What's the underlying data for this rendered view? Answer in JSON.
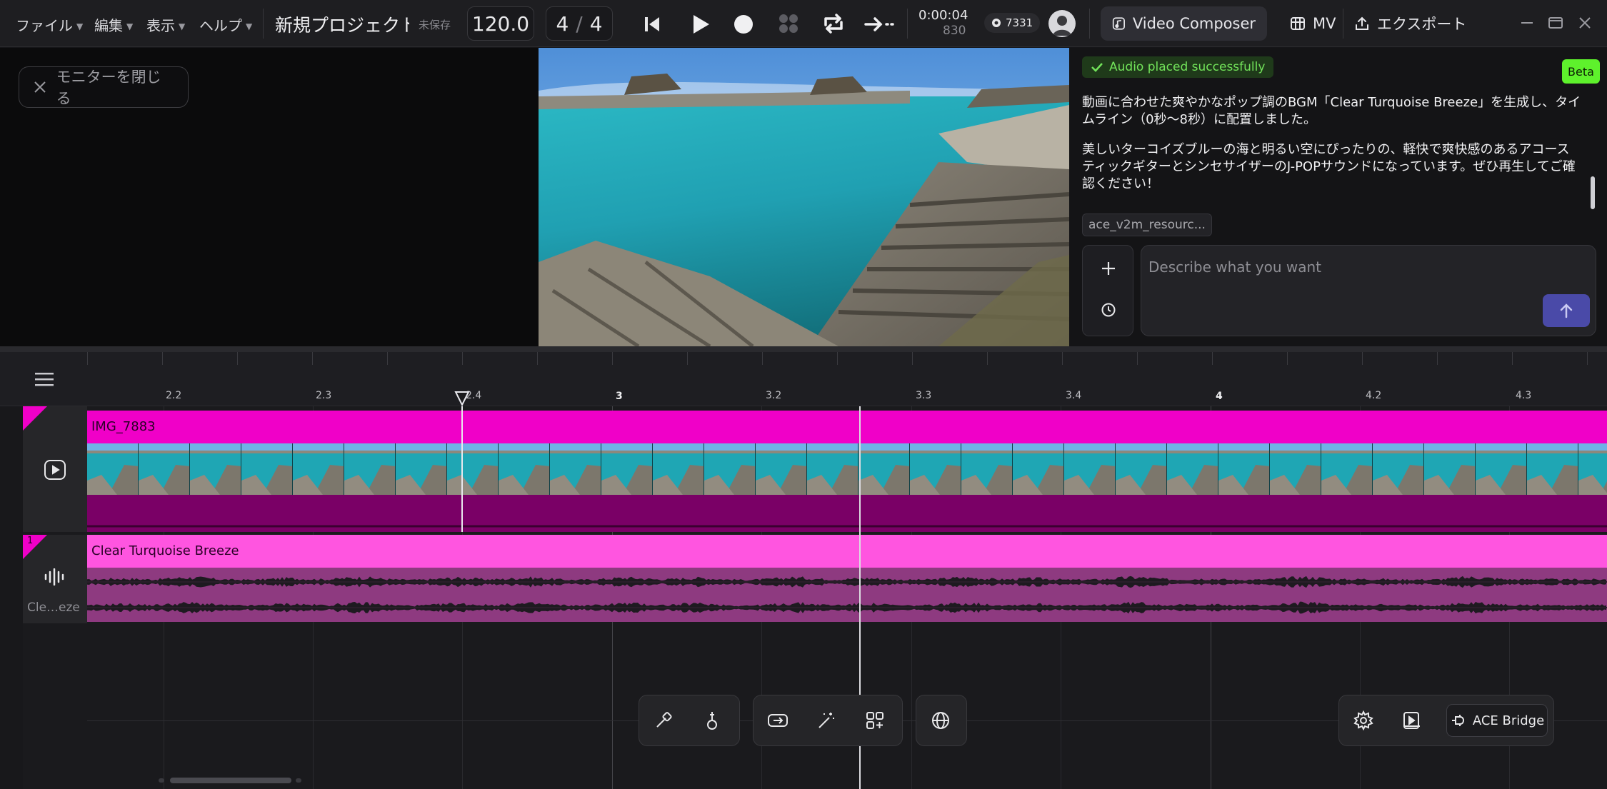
{
  "menu": {
    "file": "ファイル",
    "edit": "編集",
    "view": "表示",
    "help": "ヘルプ"
  },
  "project": {
    "title": "新規プロジェクト",
    "save_state": "未保存"
  },
  "transport": {
    "bpm": "120.0",
    "time_sig_num": "4",
    "time_sig_sep": "/",
    "time_sig_den": "4",
    "time": "0:00:04",
    "frames": "830",
    "credits": "7331"
  },
  "modes": {
    "video_composer": "Video Composer",
    "mv": "MV",
    "export": "エクスポート"
  },
  "monitor": {
    "close_label": "モニターを閉じる"
  },
  "chat": {
    "status": "Audio placed successfully",
    "beta": "Beta",
    "message_1": "動画に合わせた爽やかなポップ調のBGM「Clear Turquoise Breeze」を生成し、タイムライン（0秒〜8秒）に配置しました。",
    "message_2": "美しいターコイズブルーの海と明るい空にぴったりの、軽快で爽快感のあるアコースティックギターとシンセサイザーのJ-POPサウンドになっています。ぜひ再生してご確認ください！",
    "resource_chip": "ace_v2m_resourc...",
    "placeholder": "Describe what you want"
  },
  "timeline": {
    "ruler": {
      "labels": [
        "2.2",
        "2.3",
        "2.4",
        "3",
        "3.2",
        "3.3",
        "3.4",
        "4",
        "4.2",
        "4.3"
      ],
      "major": [
        "3",
        "4"
      ]
    },
    "tracks": {
      "video_clip": "IMG_7883",
      "audio_number": "1",
      "audio_clip": "Clear Turquoise Breeze",
      "audio_track_name": "Cle…eze"
    }
  },
  "dock": {
    "ace_bridge": "ACE Bridge"
  },
  "colors": {
    "accent_magenta": "#f000c8",
    "audio_pink": "#ff55e0",
    "success_green": "#72e35a",
    "beta_green": "#5ef12c",
    "send_purple": "#4a4aa8"
  },
  "icons": [
    "chevron-down-icon",
    "skip-back-icon",
    "play-icon",
    "record-icon",
    "grid-icon",
    "loop-icon",
    "arrow-right-icon",
    "credit-icon",
    "avatar",
    "music-note-icon",
    "globe-icon",
    "upload-icon",
    "minimize-icon",
    "maximize-icon",
    "close-icon",
    "check-icon",
    "plus-icon",
    "history-icon",
    "arrow-up-icon",
    "hamburger-icon",
    "video-icon",
    "waveform-icon",
    "wand-icon",
    "guitar-icon",
    "swap-icon",
    "magic-icon",
    "apps-plus-icon",
    "settings-icon",
    "play-box-icon",
    "plug-icon"
  ]
}
